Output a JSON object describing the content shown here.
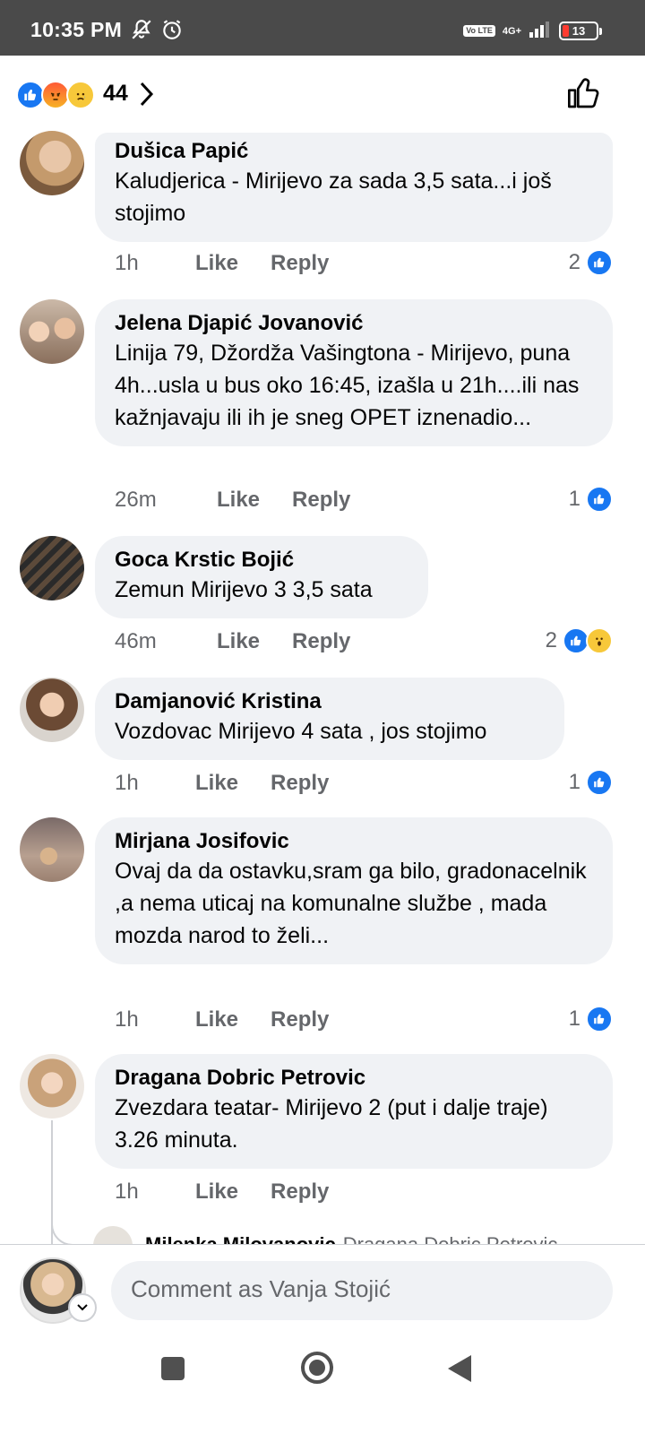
{
  "status_bar": {
    "time": "10:35 PM",
    "network": "4G+",
    "volte": "Vo LTE",
    "battery": "13",
    "icons": [
      "mute-icon",
      "alarm-icon",
      "volte-icon",
      "signal-icon",
      "battery-icon"
    ]
  },
  "reactions_header": {
    "count": "44",
    "icons": [
      "like-reaction-icon",
      "angry-reaction-icon",
      "sad-reaction-icon"
    ]
  },
  "comments": [
    {
      "author": "Dušica Papić",
      "text": "Kaludjerica - Mirijevo za sada 3,5 sata...i još stojimo",
      "time": "1h",
      "like_label": "Like",
      "reply_label": "Reply",
      "reaction_count": "2",
      "reactions": [
        "like"
      ]
    },
    {
      "author": "Jelena Djapić Jovanović",
      "text": "Linija 79, Džordža Vašingtona - Mirijevo, puna 4h...usla u bus oko 16:45, izašla u 21h....ili nas kažnjavaju ili ih je sneg OPET iznenadio...",
      "time": "26m",
      "like_label": "Like",
      "reply_label": "Reply",
      "reaction_count": "1",
      "reactions": [
        "like"
      ]
    },
    {
      "author": "Goca Krstic Bojić",
      "text": "Zemun Mirijevo 3 3,5 sata",
      "time": "46m",
      "like_label": "Like",
      "reply_label": "Reply",
      "reaction_count": "2",
      "reactions": [
        "like",
        "wow"
      ]
    },
    {
      "author": "Damjanović Kristina",
      "text": "Vozdovac Mirijevo 4 sata , jos stojimo",
      "time": "1h",
      "like_label": "Like",
      "reply_label": "Reply",
      "reaction_count": "1",
      "reactions": [
        "like"
      ]
    },
    {
      "author": "Mirjana Josifovic",
      "text": "Ovaj da da ostavku,sram ga bilo, gradonacelnik ,a nema uticaj na komunalne službe , mada mozda narod to želi...",
      "time": "1h",
      "like_label": "Like",
      "reply_label": "Reply",
      "reaction_count": "1",
      "reactions": [
        "like"
      ]
    },
    {
      "author": "Dragana Dobric Petrovic",
      "text": "Zvezdara teatar- Mirijevo 2  (put i dalje traje) 3.26 minuta.",
      "time": "1h",
      "like_label": "Like",
      "reply_label": "Reply",
      "reaction_count": "",
      "reactions": []
    }
  ],
  "reply_preview": {
    "author": "Milenka Milovanovic",
    "mention": "Dragana Dobric Petrovic"
  },
  "composer": {
    "placeholder": "Comment as Vanja Stojić"
  },
  "colors": {
    "accent": "#1877f2",
    "bubble": "#f0f2f5",
    "muted_text": "#65676b",
    "status_bar": "#4a4a4a"
  }
}
